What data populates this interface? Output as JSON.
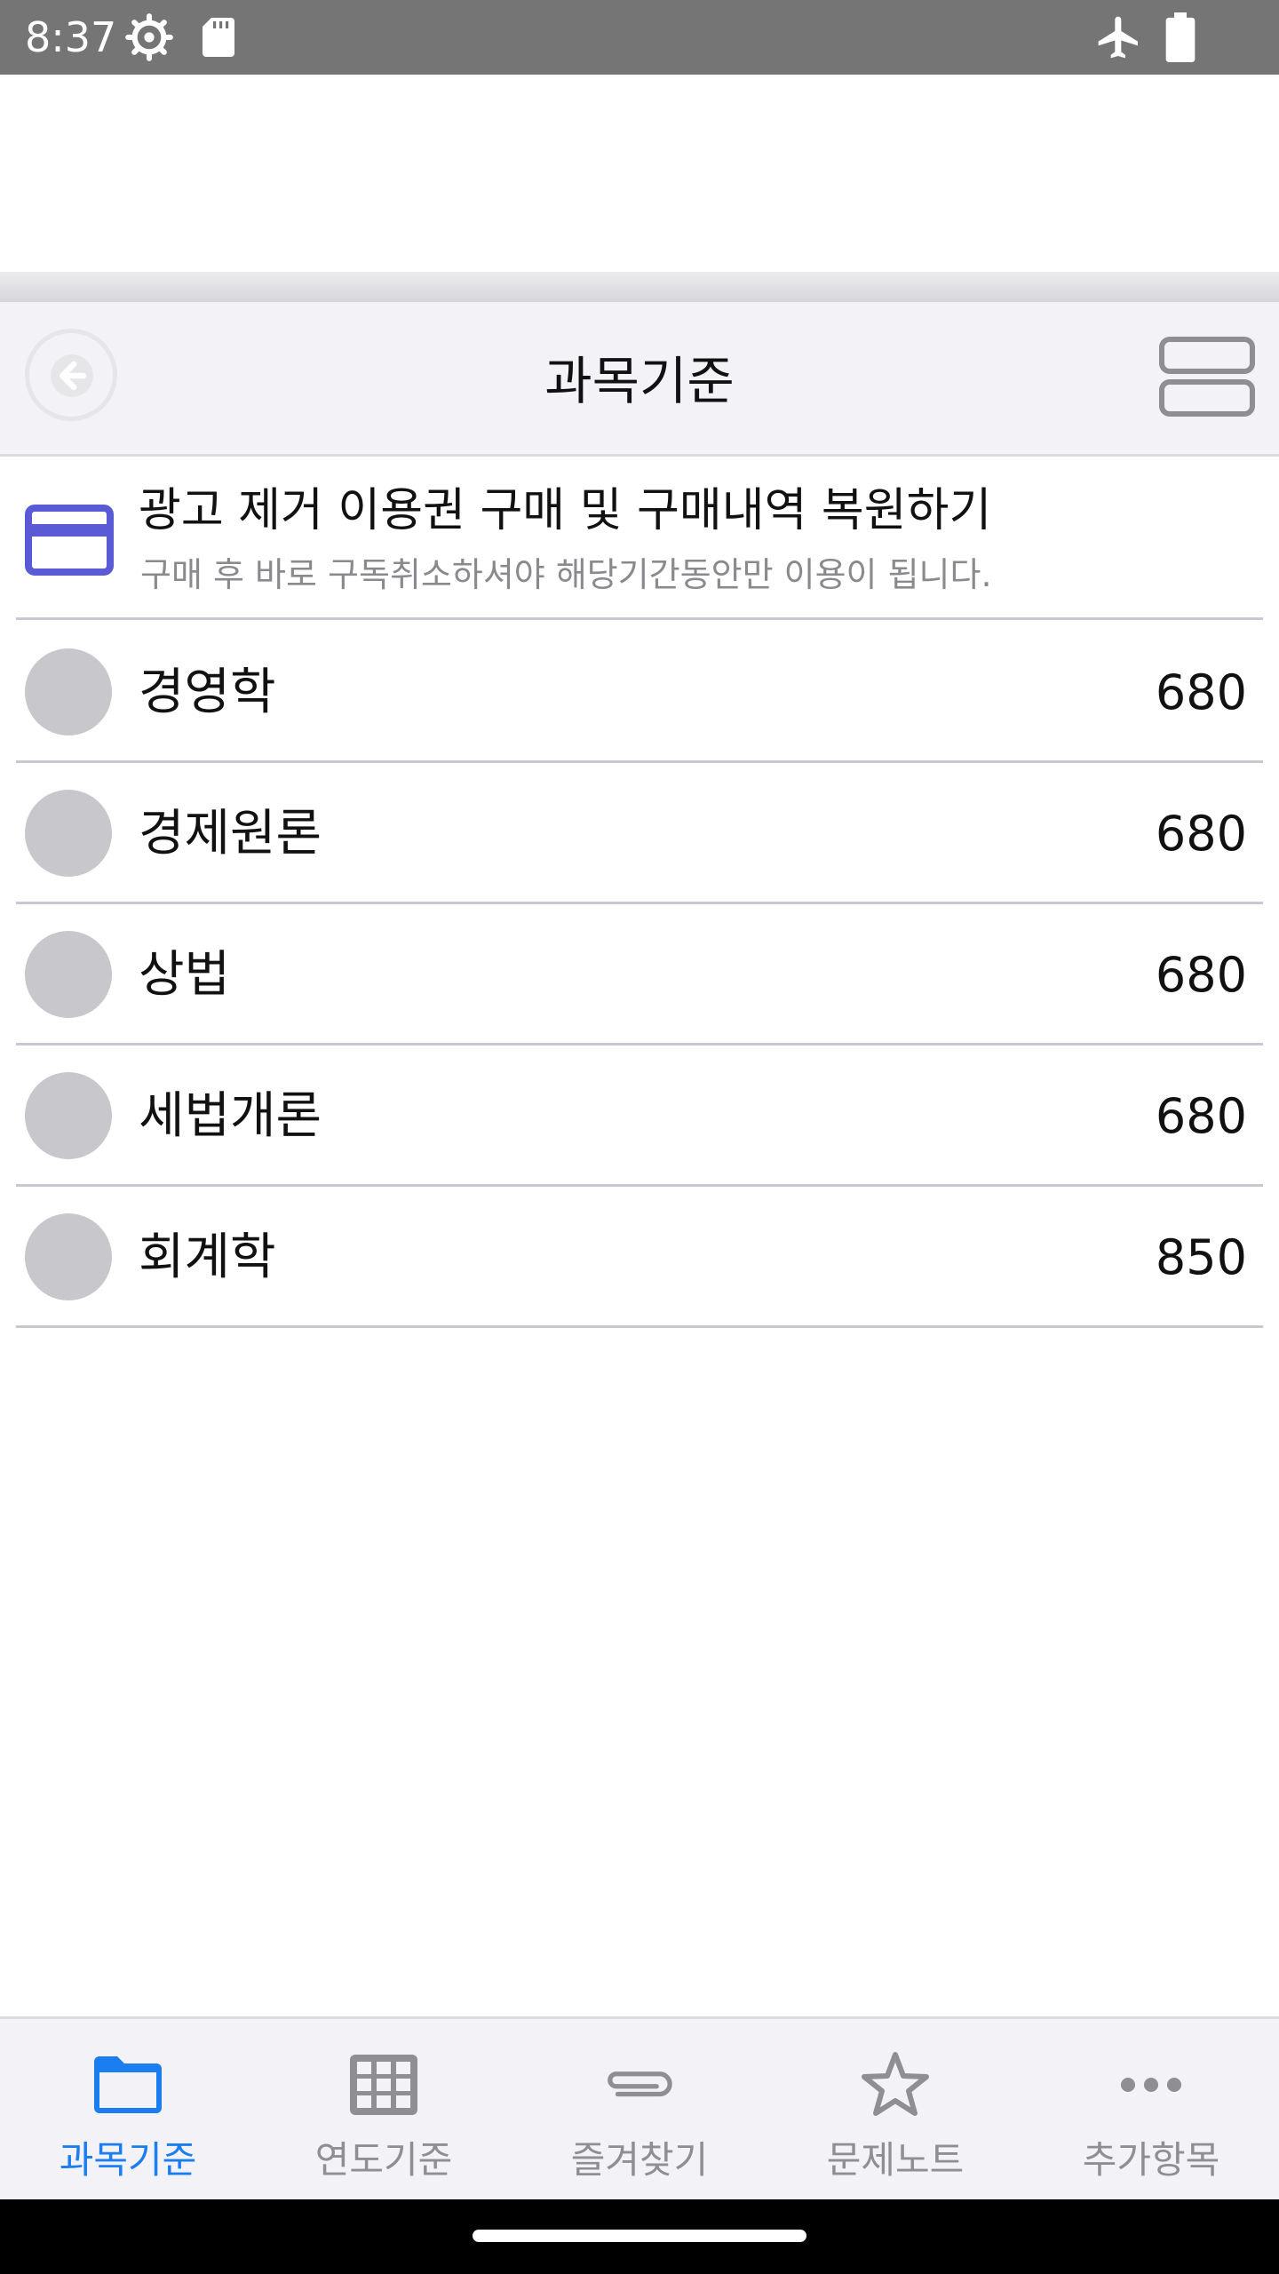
{
  "status_bar": {
    "time": "8:37"
  },
  "nav": {
    "title": "과목기준"
  },
  "promo": {
    "title": "광고 제거 이용권 구매 및 구매내역 복원하기",
    "subtitle": "구매 후 바로 구독취소하셔야 해당기간동안만 이용이 됩니다."
  },
  "subjects": [
    {
      "label": "경영학",
      "value": "680"
    },
    {
      "label": "경제원론",
      "value": "680"
    },
    {
      "label": "상법",
      "value": "680"
    },
    {
      "label": "세법개론",
      "value": "680"
    },
    {
      "label": "회계학",
      "value": "850"
    }
  ],
  "tabs": [
    {
      "label": "과목기준",
      "icon": "folder-icon",
      "active": true
    },
    {
      "label": "연도기준",
      "icon": "grid-icon",
      "active": false
    },
    {
      "label": "즐겨찾기",
      "icon": "paperclip-icon",
      "active": false
    },
    {
      "label": "문제노트",
      "icon": "star-icon",
      "active": false
    },
    {
      "label": "추가항목",
      "icon": "more-icon",
      "active": false
    }
  ],
  "colors": {
    "accent": "#1a7df0",
    "card_icon": "#5a5ad6",
    "inactive": "#8e8e93"
  }
}
